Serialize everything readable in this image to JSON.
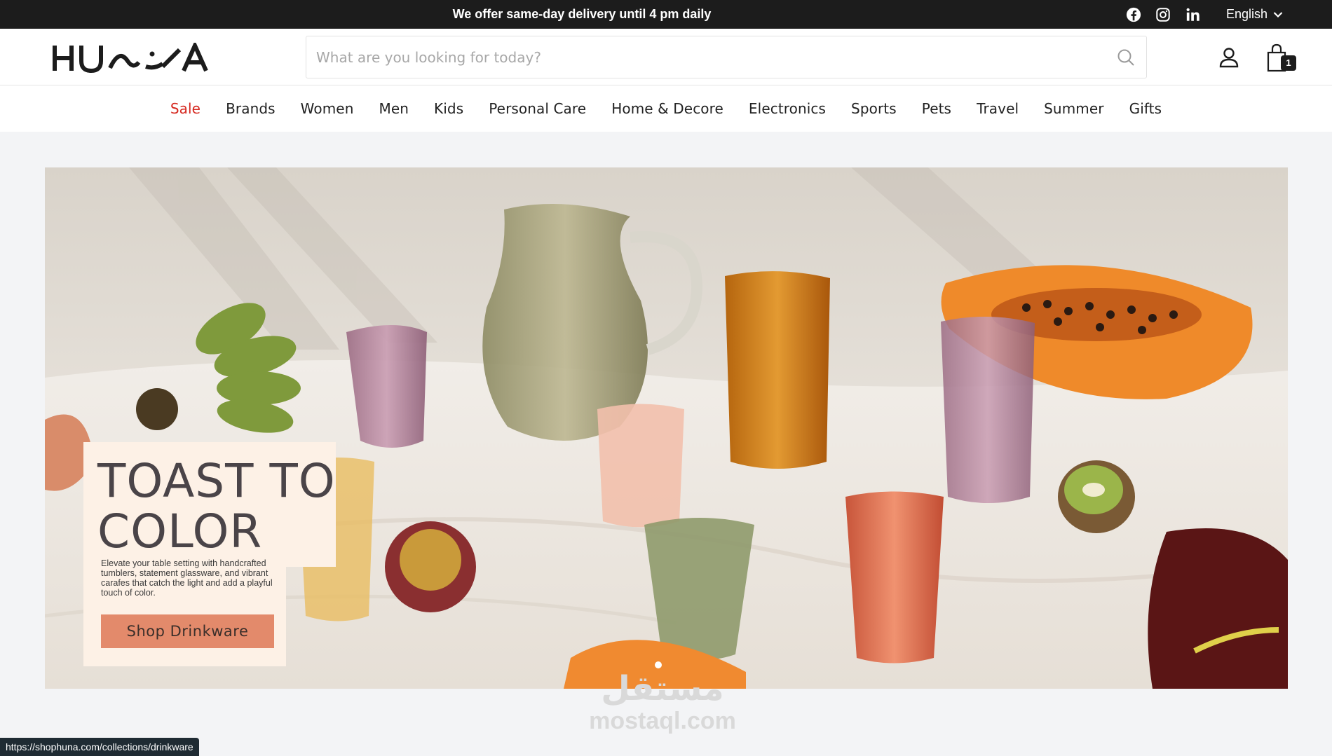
{
  "topbar": {
    "announcement": "We offer same-day delivery until 4 pm daily",
    "social": [
      "facebook-icon",
      "instagram-icon",
      "linkedin-icon"
    ],
    "language": "English"
  },
  "header": {
    "logo_text": "HUNA",
    "search_placeholder": "What are you looking for today?",
    "cart_count": "1"
  },
  "nav": {
    "items": [
      "Sale",
      "Brands",
      "Women",
      "Men",
      "Kids",
      "Personal Care",
      "Home & Decore",
      "Electronics",
      "Sports",
      "Pets",
      "Travel",
      "Summer",
      "Gifts"
    ]
  },
  "hero": {
    "title_line1": "TOAST TO",
    "title_line2": "COLOR",
    "description": "Elevate your table setting with handcrafted tumblers, statement glassware, and vibrant carafes that catch the light and add a playful touch of color.",
    "button_label": "Shop Drinkware"
  },
  "watermark": {
    "arabic": "مستقل",
    "latin": "mostaql.com"
  },
  "status_url": "https://shophuna.com/collections/drinkware",
  "colors": {
    "topbar_bg": "#1c1c1c",
    "sale_red": "#d6281f",
    "button_bg": "#e38a6b",
    "promo_bg": "#fdf1e6",
    "page_bg": "#f3f4f6"
  }
}
